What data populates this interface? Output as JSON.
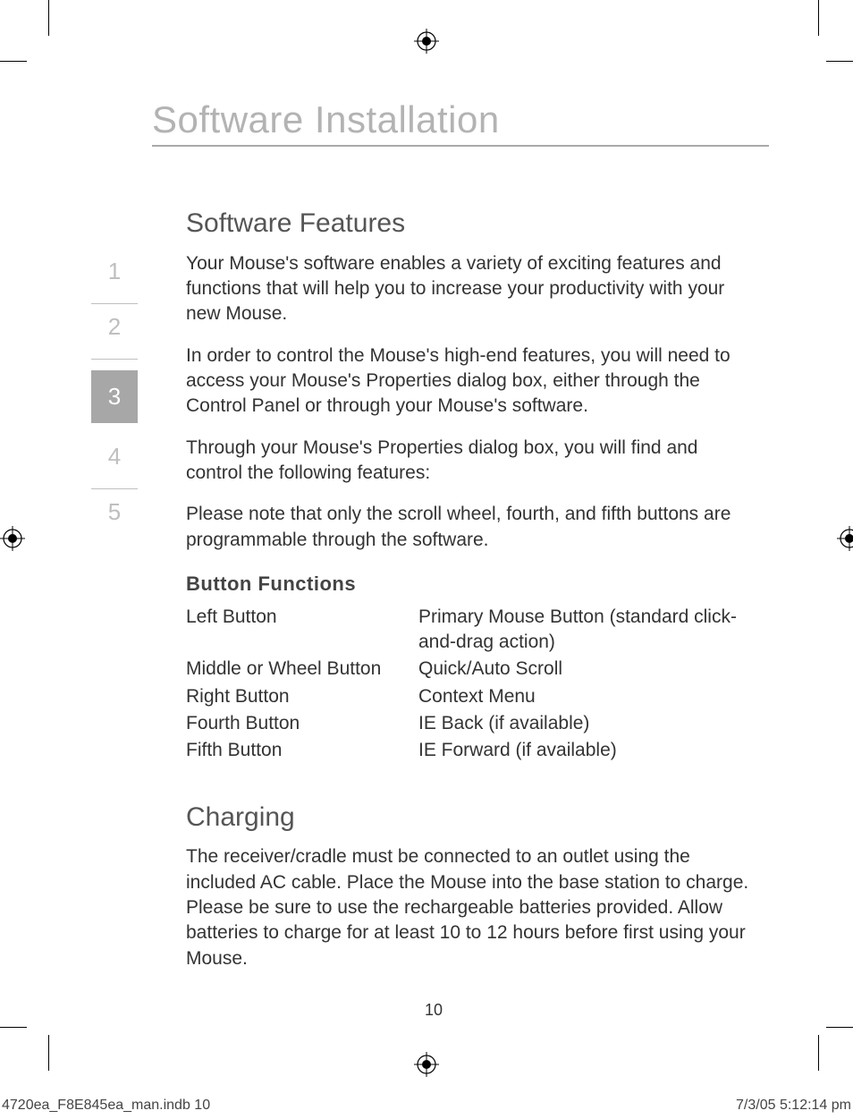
{
  "page_title": "Software Installation",
  "sidebar": {
    "items": [
      "1",
      "2",
      "3",
      "4",
      "5"
    ],
    "active_index": 2
  },
  "section1": {
    "heading": "Software Features",
    "p1": "Your Mouse's software enables a variety of exciting features and functions that will help you to increase your productivity with your new Mouse.",
    "p2": "In order to control the Mouse's high-end features, you will need to access your Mouse's Properties dialog box, either through the Control Panel or through your Mouse's software.",
    "p3": "Through your Mouse's Properties dialog box, you will find and control the following features:",
    "p4": "Please note that only the scroll wheel, fourth, and fifth buttons are programmable through the software."
  },
  "button_functions": {
    "heading": "Button Functions",
    "rows": [
      {
        "name": "Left Button",
        "desc": "Primary Mouse Button (standard click-and-drag action)"
      },
      {
        "name": "Middle or Wheel Button",
        "desc": "Quick/Auto Scroll"
      },
      {
        "name": "Right Button",
        "desc": "Context Menu"
      },
      {
        "name": "Fourth Button",
        "desc": "IE Back (if available)"
      },
      {
        "name": "Fifth Button",
        "desc": "IE Forward (if available)"
      }
    ]
  },
  "section2": {
    "heading": "Charging",
    "p1": "The receiver/cradle must be connected to an outlet using the included AC cable. Place the Mouse into the base station to charge. Please be sure to use the rechargeable batteries provided. Allow batteries to charge for at least 10 to 12 hours before first using your Mouse."
  },
  "page_number": "10",
  "footer": {
    "left": "4720ea_F8E845ea_man.indb   10",
    "right": "7/3/05   5:12:14 pm"
  }
}
